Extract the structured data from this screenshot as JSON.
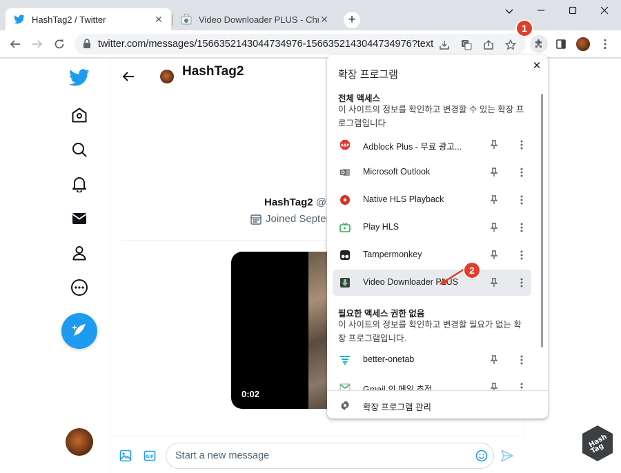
{
  "browser": {
    "tabs": [
      {
        "title": "HashTag2 / Twitter",
        "active": true
      },
      {
        "title": "Video Downloader PLUS - Chrome",
        "active": false
      }
    ],
    "address_url": "twitter.com/messages/1566352143044734976-1566352143044734976?text="
  },
  "callouts": {
    "first": "1",
    "second": "2"
  },
  "twitter": {
    "nav_icons": [
      "home-icon",
      "explore-icon",
      "notifications-icon",
      "messages-icon",
      "profile-icon",
      "more-icon"
    ],
    "header_title": "HashTag2",
    "profile_display_name": "HashTag2",
    "profile_handle": "@T",
    "joined_text": "Joined Septem",
    "video_time": "0:02",
    "composer_placeholder": "Start a new message",
    "brand_color": "#1d9bf0"
  },
  "extensions_popup": {
    "title": "확장 프로그램",
    "full_access_heading": "전체 액세스",
    "full_access_desc": "이 사이트의 정보를 확인하고 변경할 수 있는 확장 프로그램입니다",
    "full_access_items": [
      {
        "name": "Adblock Plus - 무료 광고...",
        "icon": "abp-icon"
      },
      {
        "name": "Microsoft Outlook",
        "icon": "outlook-icon"
      },
      {
        "name": "Native HLS Playback",
        "icon": "hls-playback-icon"
      },
      {
        "name": "Play HLS",
        "icon": "tv-icon"
      },
      {
        "name": "Tampermonkey",
        "icon": "tampermonkey-icon"
      },
      {
        "name": "Video Downloader PLUS",
        "icon": "download-arrow-icon",
        "highlighted": true
      }
    ],
    "no_access_heading": "필요한 액세스 권한 없음",
    "no_access_desc": "이 사이트의 정보를 확인하고 변경할 필요가 없는 확장 프로그램입니다.",
    "no_access_items": [
      {
        "name": "better-onetab",
        "icon": "onetab-icon"
      },
      {
        "name": "Gmail 의 메일 추적",
        "icon": "gmail-icon"
      }
    ],
    "manage_label": "확장 프로그램 관리"
  },
  "watermark_text": "Hash Tag"
}
